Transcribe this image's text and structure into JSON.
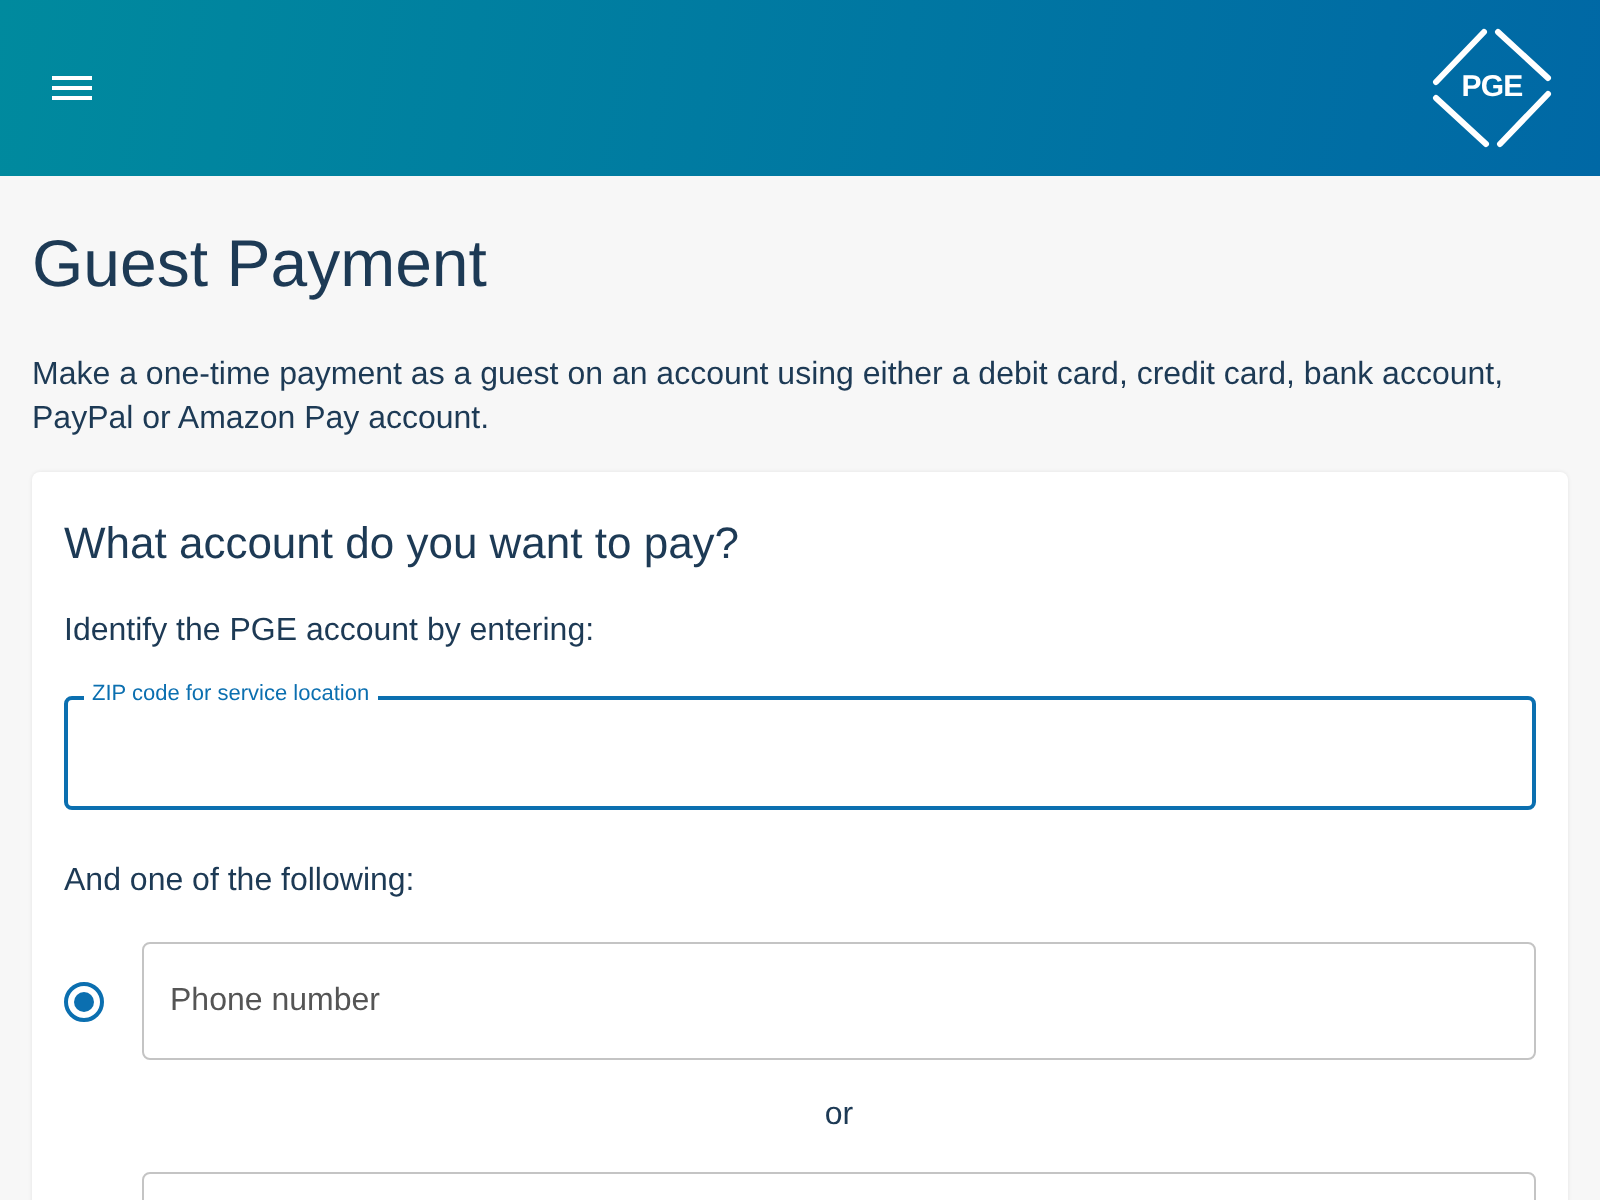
{
  "header": {
    "logo": "PGE"
  },
  "page": {
    "title": "Guest Payment",
    "intro": "Make a one-time payment as a guest on an account using either a debit card, credit card, bank account, PayPal or Amazon Pay account."
  },
  "card": {
    "heading": "What account do you want to pay?",
    "identify_label": "Identify the PGE account by entering:",
    "zip_field": {
      "label": "ZIP code for service location",
      "focused": true
    },
    "choice_label": "And one of the following:",
    "options": [
      {
        "kind": "field",
        "placeholder": "Phone number",
        "selected": true
      },
      {
        "kind": "field"
      }
    ],
    "separator": "or"
  }
}
